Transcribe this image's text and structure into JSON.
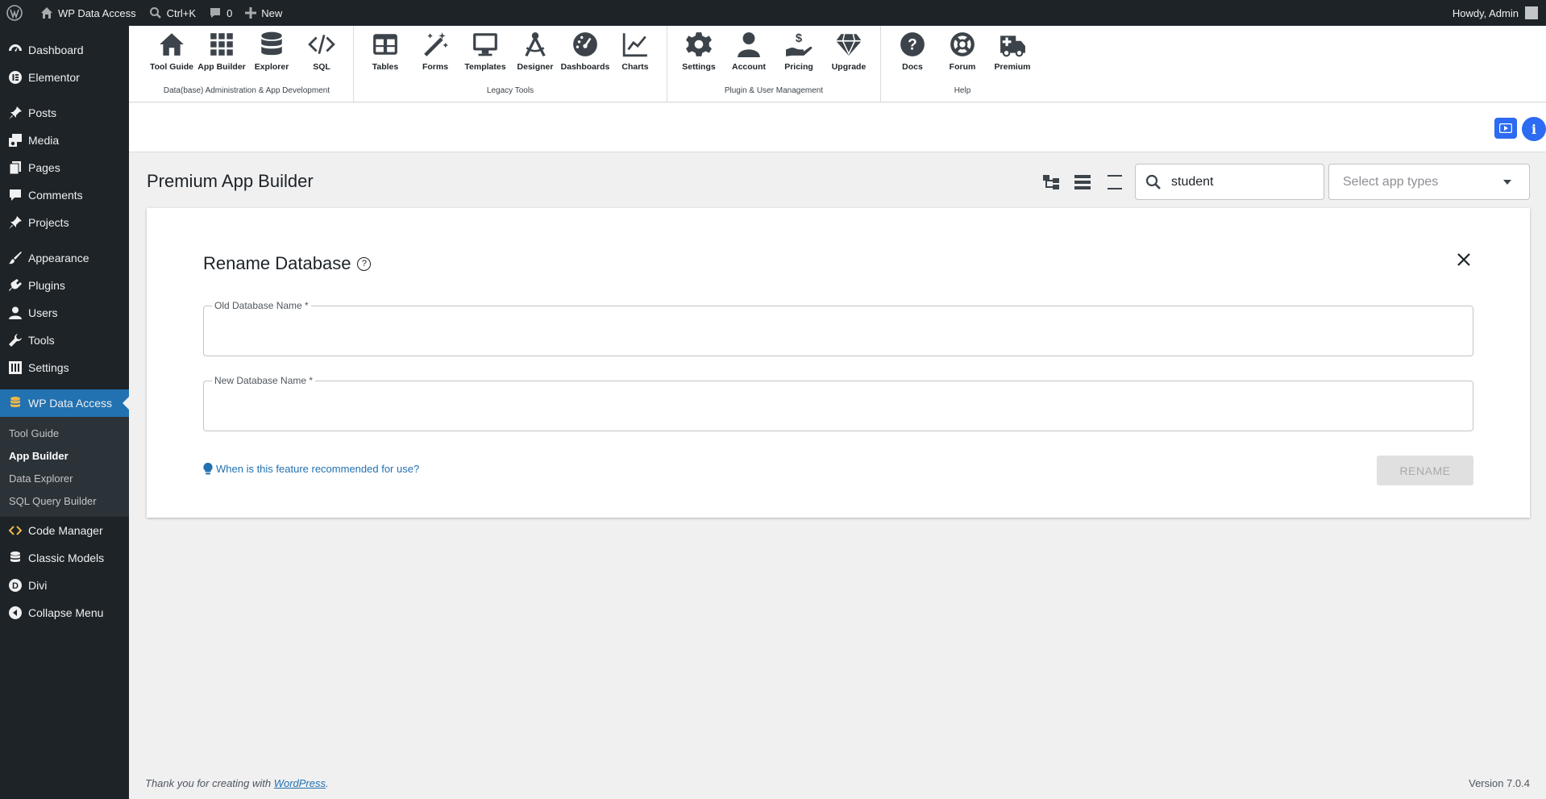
{
  "adminbar": {
    "site_name": "WP Data Access",
    "search_shortcut": "Ctrl+K",
    "comments_count": "0",
    "new_label": "New",
    "howdy": "Howdy, Admin"
  },
  "sidebar": {
    "items": [
      {
        "label": "Dashboard"
      },
      {
        "label": "Elementor"
      },
      {
        "label": "Posts"
      },
      {
        "label": "Media"
      },
      {
        "label": "Pages"
      },
      {
        "label": "Comments"
      },
      {
        "label": "Projects"
      },
      {
        "label": "Appearance"
      },
      {
        "label": "Plugins"
      },
      {
        "label": "Users"
      },
      {
        "label": "Tools"
      },
      {
        "label": "Settings"
      },
      {
        "label": "WP Data Access"
      },
      {
        "label": "Code Manager"
      },
      {
        "label": "Classic Models"
      },
      {
        "label": "Divi"
      },
      {
        "label": "Collapse Menu"
      }
    ],
    "submenu": [
      {
        "label": "Tool Guide"
      },
      {
        "label": "App Builder"
      },
      {
        "label": "Data Explorer"
      },
      {
        "label": "SQL Query Builder"
      }
    ]
  },
  "toolbar": {
    "groups": [
      {
        "label": "Data(base) Administration & App Development",
        "tools": [
          "Tool Guide",
          "App Builder",
          "Explorer",
          "SQL"
        ]
      },
      {
        "label": "Legacy Tools",
        "tools": [
          "Tables",
          "Forms",
          "Templates",
          "Designer",
          "Dashboards",
          "Charts"
        ]
      },
      {
        "label": "Plugin & User Management",
        "tools": [
          "Settings",
          "Account",
          "Pricing",
          "Upgrade"
        ]
      },
      {
        "label": "Help",
        "tools": [
          "Docs",
          "Forum",
          "Premium"
        ]
      }
    ]
  },
  "main": {
    "page_title": "Premium App Builder",
    "search_value": "student",
    "select_placeholder": "Select app types"
  },
  "dialog": {
    "title": "Rename Database",
    "old_label": "Old Database Name *",
    "new_label": "New Database Name *",
    "hint": "When is this feature recommended for use?",
    "rename_label": "RENAME"
  },
  "footer": {
    "thanks_prefix": "Thank you for creating with ",
    "wp_link": "WordPress",
    "thanks_suffix": ".",
    "version": "Version 7.0.4"
  },
  "colors": {
    "accent": "#2271b1",
    "brand_blue": "#2c6bf2",
    "sidebar_bg": "#1d2327"
  }
}
